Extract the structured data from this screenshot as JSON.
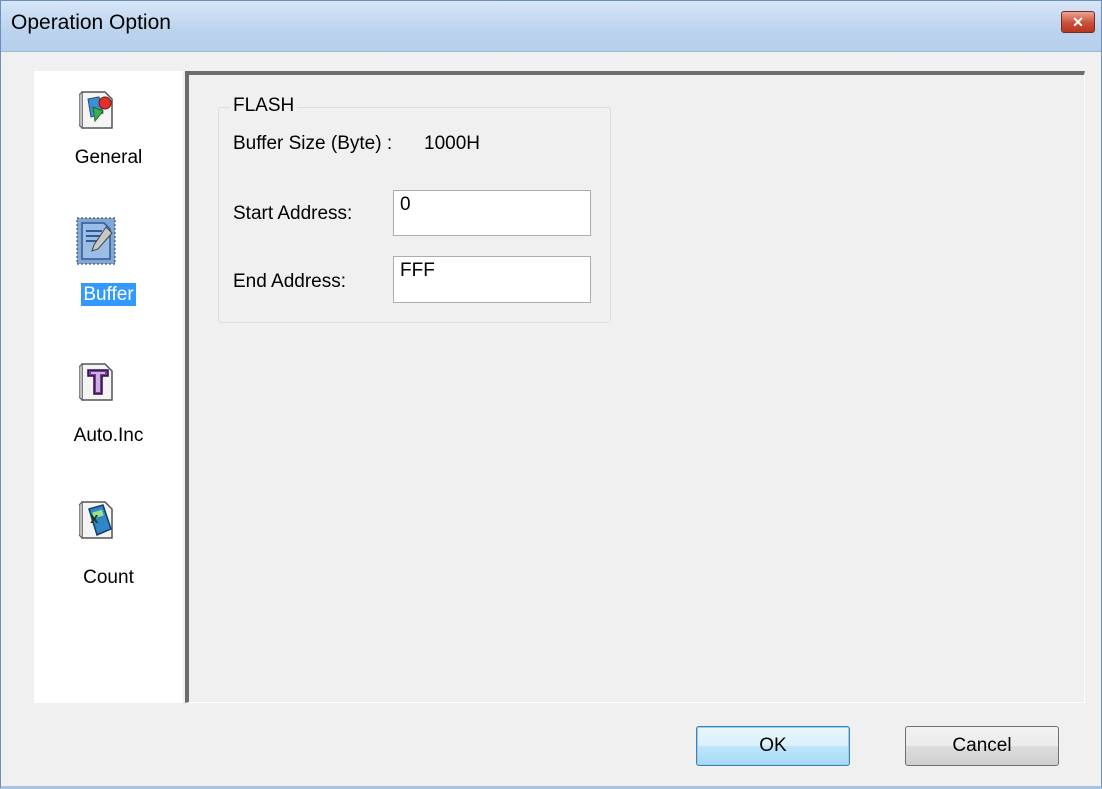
{
  "window": {
    "title": "Operation Option",
    "close_glyph": "✕"
  },
  "sidebar": {
    "items": [
      {
        "label": "General",
        "icon": "general-icon",
        "selected": false
      },
      {
        "label": "Buffer",
        "icon": "buffer-icon",
        "selected": true
      },
      {
        "label": "Auto.Inc",
        "icon": "auto-inc-icon",
        "selected": false
      },
      {
        "label": "Count",
        "icon": "count-icon",
        "selected": false
      }
    ]
  },
  "flash_group": {
    "title": "FLASH",
    "buffer_size_label": "Buffer Size (Byte) :",
    "buffer_size_value": "1000H",
    "start_address_label": "Start Address:",
    "start_address_value": "0",
    "end_address_label": "End Address:",
    "end_address_value": "FFF"
  },
  "buttons": {
    "ok": "OK",
    "cancel": "Cancel"
  },
  "colors": {
    "selection": "#3399ff",
    "title_bar": "#bcd3ee",
    "close_button": "#c9503a"
  }
}
